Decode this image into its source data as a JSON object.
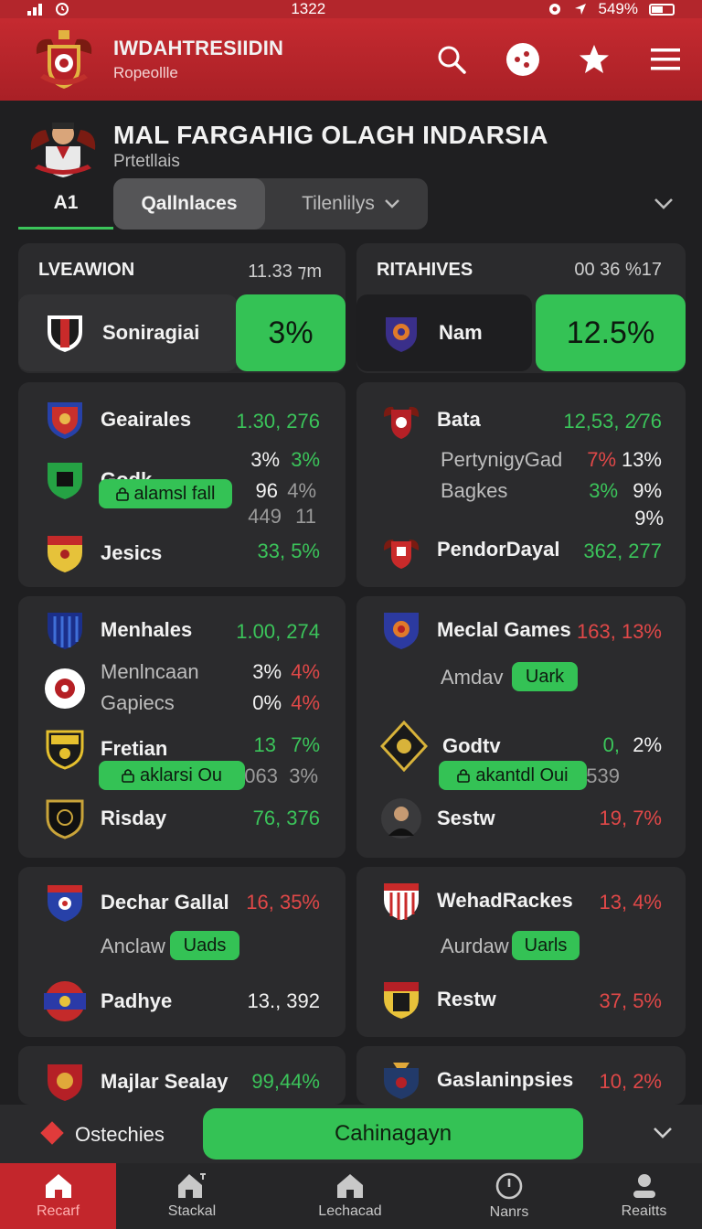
{
  "status": {
    "time": "1322",
    "battery": "549%"
  },
  "app": {
    "title": "IWDAHTRESIIDIN",
    "subtitle": "Ropeollle"
  },
  "league": {
    "title": "MAL FARGAHIG OLAGH INDARSIA",
    "subtitle": "Prtetllais"
  },
  "tabs": {
    "first": "A1",
    "active": "Qallnlaces",
    "other": "Tilenlilys"
  },
  "highlight": [
    {
      "title": "LVEAWION",
      "meta": "11.33 ⁊m",
      "team": "Soniragiai",
      "pct": "3%"
    },
    {
      "title": "RITAHIVES",
      "meta": "00 36 %17",
      "team": "Nam",
      "pct": "12.5%"
    }
  ],
  "cards": {
    "c1": {
      "r1_name": "Geairales",
      "r1_val": "1.30, 276",
      "r2_name": "Godk",
      "r2_a": "3%",
      "r2_b": "3%",
      "r2_pill": "alamsl fall",
      "r2_c": "96",
      "r2_d": "4%",
      "r2_e": "449",
      "r2_f": "11",
      "r3_name": "Jesics",
      "r3_val": "33, 5%"
    },
    "c2": {
      "r1_name": "Bata",
      "r1_val": "12,53, 2⁄76",
      "s1_name": "PertynigyGad",
      "s1_a": "7%",
      "s1_b": "13%",
      "s2_name": "Bagkes",
      "s2_a": "3%",
      "s2_b": "9%",
      "s2_c": "9%",
      "r3_name": "PendorDayal",
      "r3_val": "362, 277"
    },
    "c3": {
      "r1_name": "Menhales",
      "r1_val": "1.00, 274",
      "s1_name": "Menlncaan",
      "s1_a": "3%",
      "s1_b": "4%",
      "s2_name": "Gapiecs",
      "s2_a": "0%",
      "s2_b": "4%",
      "r2_name": "Fretian",
      "r2_a": "13",
      "r2_b": "7%",
      "r2_pill": "aklarsi Ou",
      "r2_c": "063",
      "r2_d": "3%",
      "r3_name": "Risday",
      "r3_val": "76, 376"
    },
    "c4": {
      "r1_name": "Meclal Games",
      "r1_val": "163, 13%",
      "s1_name": "Amdav",
      "s1_pill": "Uark",
      "r2_name": "Godtv",
      "r2_a": "0,",
      "r2_b": "2%",
      "r2_pill": "akantdl Oui",
      "r2_c": "539",
      "r3_name": "Sestw",
      "r3_val": "19, 7%"
    },
    "c5": {
      "r1_name": "Dechar Gallal",
      "r1_val": "16, 35%",
      "s1_name": "Anclaw",
      "s1_pill": "Uads",
      "r2_name": "Padhye",
      "r2_val": "13., 392"
    },
    "c6": {
      "r1_name": "WehadRackes",
      "r1_val": "13, 4%",
      "s1_name": "Aurdaw",
      "s1_pill": "Uarls",
      "r2_name": "Restw",
      "r2_val": "37, 5%"
    },
    "c7": {
      "r1_name": "Majlar Sealay",
      "r1_val": "99,44%"
    },
    "c8": {
      "r1_name": "Gaslaninpsies",
      "r1_val": "10, 2%"
    }
  },
  "action": {
    "label": "Ostechies",
    "button": "Cahinagayn"
  },
  "nav": [
    "Recarf",
    "Stackal",
    "Lechacad",
    "Nanrs",
    "Reaitts"
  ],
  "colors": {
    "brand": "#c3262c",
    "accent": "#34c255",
    "negative": "#e04848",
    "surface": "#2b2b2d"
  }
}
